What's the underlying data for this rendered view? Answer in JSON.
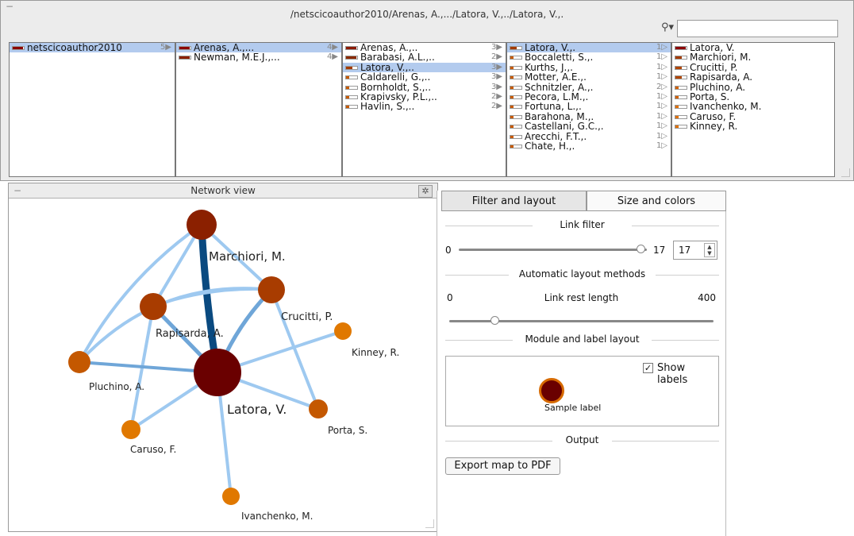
{
  "browser": {
    "path": "/netscicoauthor2010/Arenas, A.,.../Latora, V.,../Latora, V.,.",
    "search_value": "",
    "columns": [
      {
        "items": [
          {
            "label": "netscicoauthor2010",
            "count": "5▶",
            "selected": true,
            "fill": 0.9,
            "color": "#8b0000"
          }
        ]
      },
      {
        "items": [
          {
            "label": "Arenas, A.,...",
            "count": "4▶",
            "selected": true,
            "fill": 0.9,
            "color": "#8b0000"
          },
          {
            "label": "Newman, M.E.J.,...",
            "count": "4▶",
            "selected": false,
            "fill": 0.9,
            "color": "#8b2000"
          }
        ]
      },
      {
        "items": [
          {
            "label": "Arenas, A.,..",
            "count": "3▶",
            "selected": false,
            "fill": 0.9,
            "color": "#8b1a00"
          },
          {
            "label": "Barabasi, A.L.,..",
            "count": "2▶",
            "selected": false,
            "fill": 0.9,
            "color": "#8b2a00"
          },
          {
            "label": "Latora, V.,..",
            "count": "3▶",
            "selected": true,
            "fill": 0.6,
            "color": "#a33a00"
          },
          {
            "label": "Caldarelli, G.,..",
            "count": "3▶",
            "selected": false,
            "fill": 0.3,
            "color": "#c75a00"
          },
          {
            "label": "Bornholdt, S.,..",
            "count": "3▶",
            "selected": false,
            "fill": 0.3,
            "color": "#c75a00"
          },
          {
            "label": "Krapivsky, P.L.,..",
            "count": "2▶",
            "selected": false,
            "fill": 0.3,
            "color": "#c75a00"
          },
          {
            "label": "Havlin, S.,..",
            "count": "2▶",
            "selected": false,
            "fill": 0.3,
            "color": "#c75a00"
          }
        ]
      },
      {
        "items": [
          {
            "label": "Latora, V.,.",
            "count": "1▷",
            "selected": true,
            "fill": 0.6,
            "color": "#a33a00"
          },
          {
            "label": "Boccaletti, S.,.",
            "count": "1▷",
            "selected": false,
            "fill": 0.3,
            "color": "#c75a00"
          },
          {
            "label": "Kurths, J.,.",
            "count": "1▷",
            "selected": false,
            "fill": 0.3,
            "color": "#c75a00"
          },
          {
            "label": "Motter, A.E.,.",
            "count": "1▷",
            "selected": false,
            "fill": 0.3,
            "color": "#c75a00"
          },
          {
            "label": "Schnitzler, A.,.",
            "count": "2▷",
            "selected": false,
            "fill": 0.3,
            "color": "#c75a00"
          },
          {
            "label": "Pecora, L.M.,.",
            "count": "1▷",
            "selected": false,
            "fill": 0.3,
            "color": "#c75a00"
          },
          {
            "label": "Fortuna, L.,.",
            "count": "1▷",
            "selected": false,
            "fill": 0.3,
            "color": "#c75a00"
          },
          {
            "label": "Barahona, M.,.",
            "count": "1▷",
            "selected": false,
            "fill": 0.3,
            "color": "#c75a00"
          },
          {
            "label": "Castellani, G.C.,.",
            "count": "1▷",
            "selected": false,
            "fill": 0.3,
            "color": "#c75a00"
          },
          {
            "label": "Arecchi, F.T.,.",
            "count": "1▷",
            "selected": false,
            "fill": 0.3,
            "color": "#c75a00"
          },
          {
            "label": "Chate, H.,.",
            "count": "1▷",
            "selected": false,
            "fill": 0.3,
            "color": "#c75a00"
          }
        ]
      },
      {
        "items": [
          {
            "label": "Latora, V.",
            "count": "",
            "selected": false,
            "fill": 0.9,
            "color": "#8b0000"
          },
          {
            "label": "Marchiori, M.",
            "count": "",
            "selected": false,
            "fill": 0.6,
            "color": "#a33a00"
          },
          {
            "label": "Crucitti, P.",
            "count": "",
            "selected": false,
            "fill": 0.6,
            "color": "#b04500"
          },
          {
            "label": "Rapisarda, A.",
            "count": "",
            "selected": false,
            "fill": 0.6,
            "color": "#b04500"
          },
          {
            "label": "Pluchino, A.",
            "count": "",
            "selected": false,
            "fill": 0.3,
            "color": "#d06000"
          },
          {
            "label": "Porta, S.",
            "count": "",
            "selected": false,
            "fill": 0.3,
            "color": "#d06000"
          },
          {
            "label": "Ivanchenko, M.",
            "count": "",
            "selected": false,
            "fill": 0.3,
            "color": "#e07000"
          },
          {
            "label": "Caruso, F.",
            "count": "",
            "selected": false,
            "fill": 0.3,
            "color": "#e07000"
          },
          {
            "label": "Kinney, R.",
            "count": "",
            "selected": false,
            "fill": 0.3,
            "color": "#e07000"
          }
        ]
      }
    ]
  },
  "network": {
    "title": "Network view",
    "labels": {
      "marchiori": "Marchiori, M.",
      "crucitti": "Crucitti, P.",
      "rapisarda": "Rapisarda, A.",
      "kinney": "Kinney, R.",
      "pluchino": "Pluchino, A.",
      "latora": "Latora, V.",
      "porta": "Porta, S.",
      "caruso": "Caruso, F.",
      "ivanchenko": "Ivanchenko, M."
    },
    "colors": {
      "dark": "#6a0000",
      "brown": "#8b2000",
      "rust": "#a83c00",
      "orange": "#c45800",
      "light_orange": "#e07800",
      "link_light": "#9ec9f0",
      "link_mid": "#6fa6d8",
      "link_dark": "#0a4a80"
    }
  },
  "panel": {
    "tabs": [
      "Filter and layout",
      "Size and colors"
    ],
    "link_filter": {
      "title": "Link filter",
      "min": "0",
      "max": "17",
      "value": "17"
    },
    "auto_layout": {
      "title": "Automatic layout methods",
      "rest_label": "Link rest length",
      "min": "0",
      "max": "400",
      "level": 0.17
    },
    "module_layout": {
      "title": "Module and label layout",
      "show_labels": "Show labels",
      "sample": "Sample label"
    },
    "output": {
      "title": "Output",
      "export": "Export map to PDF"
    }
  }
}
